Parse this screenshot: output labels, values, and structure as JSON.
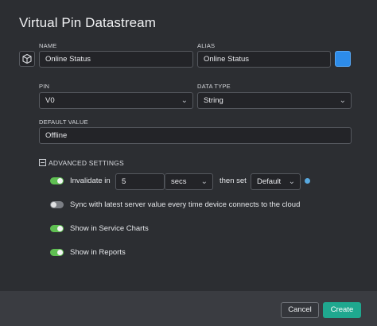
{
  "dialog": {
    "title": "Virtual Pin Datastream"
  },
  "name": {
    "label": "NAME",
    "value": "Online Status"
  },
  "alias": {
    "label": "ALIAS",
    "value": "Online Status"
  },
  "pin": {
    "label": "PIN",
    "value": "V0"
  },
  "data_type": {
    "label": "DATA TYPE",
    "value": "String"
  },
  "default_value": {
    "label": "DEFAULT VALUE",
    "value": "Offline"
  },
  "advanced": {
    "label": "ADVANCED SETTINGS",
    "invalidate": {
      "label": "Invalidate in",
      "enabled": true,
      "amount": "5",
      "unit": "secs",
      "then_label": "then set",
      "then_value": "Default"
    },
    "sync": {
      "label": "Sync with latest server value every time device connects to the cloud",
      "enabled": false
    },
    "service_charts": {
      "label": "Show in Service Charts",
      "enabled": true
    },
    "reports": {
      "label": "Show in Reports",
      "enabled": true
    }
  },
  "footer": {
    "cancel_label": "Cancel",
    "create_label": "Create"
  },
  "colors": {
    "accent": "#1fa88f",
    "swatch": "#2d8cea",
    "toggle_on": "#5fbf52"
  }
}
